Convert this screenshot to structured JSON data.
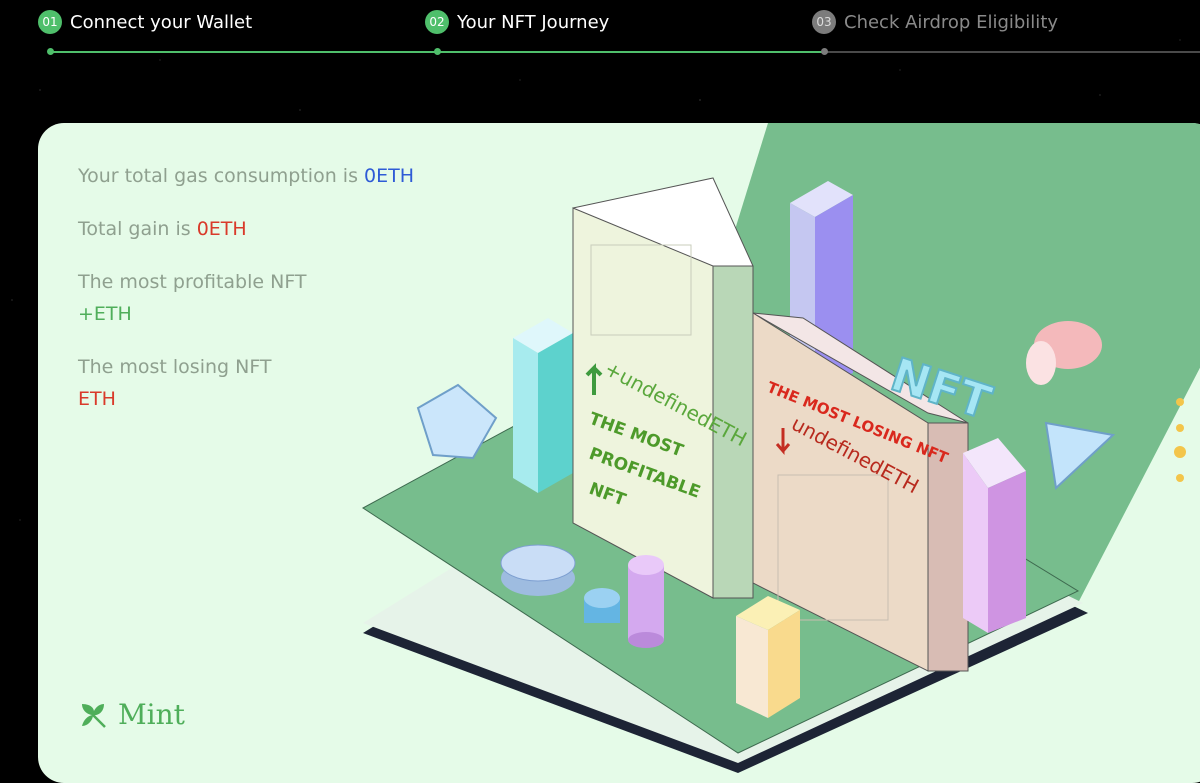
{
  "stepper": {
    "steps": [
      {
        "num": "01",
        "label": "Connect your Wallet",
        "state": "done"
      },
      {
        "num": "02",
        "label": "Your NFT Journey",
        "state": "active"
      },
      {
        "num": "03",
        "label": "Check Airdrop Eligibility",
        "state": "todo"
      }
    ]
  },
  "stats": {
    "gas_label": "Your total gas consumption is ",
    "gas_value": "0ETH",
    "gain_label": "Total gain is ",
    "gain_value": "0ETH",
    "profitable_label": "The most profitable NFT",
    "profitable_value": "+ETH",
    "losing_label": "The most losing NFT",
    "losing_value": "ETH"
  },
  "illustration": {
    "profit_amount": "+undefinedETH",
    "profit_caption": [
      "THE MOST",
      "PROFITABLE",
      "NFT"
    ],
    "loss_caption": "THE MOST LOSING NFT",
    "loss_amount": "undefinedETH",
    "nft_sign": "NFT"
  },
  "brand": {
    "name": "Mint"
  },
  "colors": {
    "accent_green": "#4fbf6b",
    "card_bg": "#e5fbe8",
    "gas_blue": "#2e5bd6",
    "loss_red": "#d93a2a",
    "profit_green": "#4fae5a"
  }
}
